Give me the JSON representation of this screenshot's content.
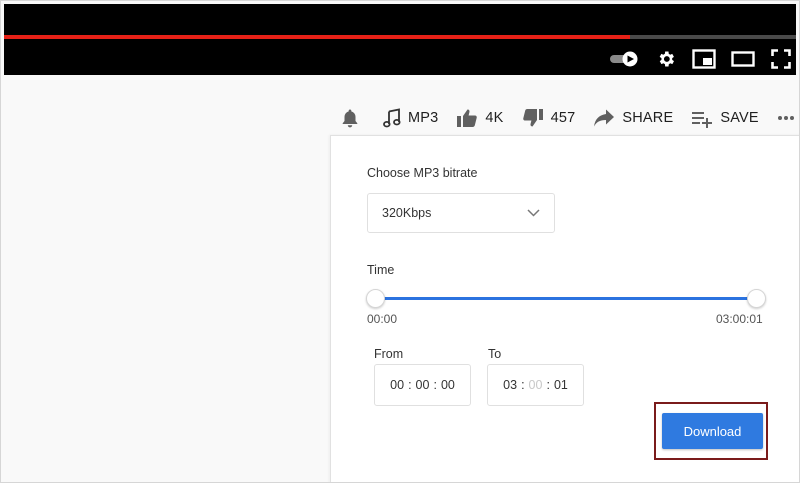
{
  "player": {
    "progress": 0.79,
    "controls": [
      "autoplay-toggle-icon",
      "settings-gear-icon",
      "miniplayer-icon",
      "theater-mode-icon",
      "fullscreen-icon"
    ]
  },
  "actions": {
    "mp3_label": "MP3",
    "like_count": "4K",
    "dislike_count": "457",
    "share_label": "SHARE",
    "save_label": "SAVE"
  },
  "panel": {
    "bitrate_label": "Choose MP3 bitrate",
    "bitrate_value": "320Kbps",
    "time_label": "Time",
    "range_start": "00:00",
    "range_end": "03:00:01",
    "from_label": "From",
    "to_label": "To",
    "from": {
      "h": "00",
      "m": "00",
      "s": "00"
    },
    "to": {
      "h": "03",
      "m": "00",
      "s": "01"
    },
    "download_label": "Download"
  },
  "colors": {
    "accent": "#2f7ae0",
    "progress": "#e62117",
    "highlight_border": "#7a1b1b"
  }
}
